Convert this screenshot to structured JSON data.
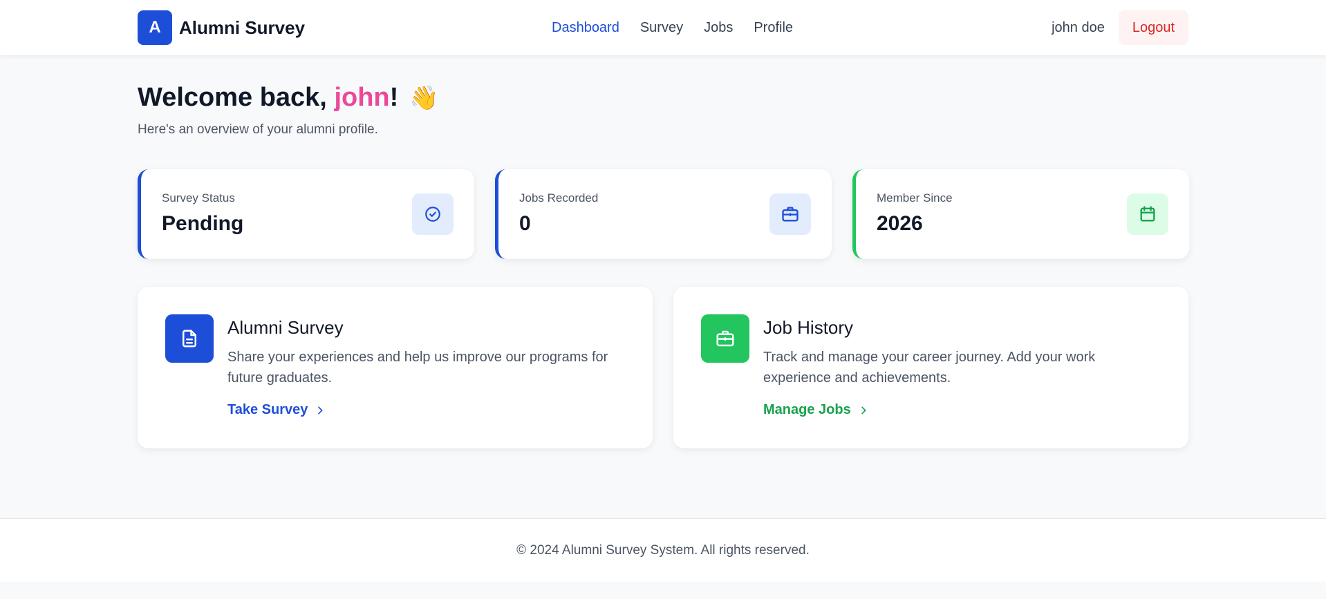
{
  "header": {
    "logo_letter": "A",
    "brand": "Alumni Survey",
    "nav": [
      {
        "label": "Dashboard",
        "active": true
      },
      {
        "label": "Survey",
        "active": false
      },
      {
        "label": "Jobs",
        "active": false
      },
      {
        "label": "Profile",
        "active": false
      }
    ],
    "user_name": "john doe",
    "logout_label": "Logout"
  },
  "welcome": {
    "prefix": "Welcome back, ",
    "name": "john",
    "suffix": "!",
    "emoji": "👋",
    "subtitle": "Here's an overview of your alumni profile."
  },
  "stats": [
    {
      "label": "Survey Status",
      "value": "Pending",
      "icon": "check-circle-icon",
      "accent": "#1d4ed8"
    },
    {
      "label": "Jobs Recorded",
      "value": "0",
      "icon": "briefcase-icon",
      "accent": "#1d4ed8"
    },
    {
      "label": "Member Since",
      "value": "2026",
      "icon": "calendar-icon",
      "accent": "#22c55e"
    }
  ],
  "actions": [
    {
      "title": "Alumni Survey",
      "description": "Share your experiences and help us improve our programs for future graduates.",
      "link": "Take Survey",
      "icon": "document-icon",
      "color": "#1d4ed8"
    },
    {
      "title": "Job History",
      "description": "Track and manage your career journey. Add your work experience and achievements.",
      "link": "Manage Jobs",
      "icon": "briefcase-icon",
      "color": "#22c55e"
    }
  ],
  "footer": {
    "text": "© 2024 Alumni Survey System. All rights reserved."
  }
}
